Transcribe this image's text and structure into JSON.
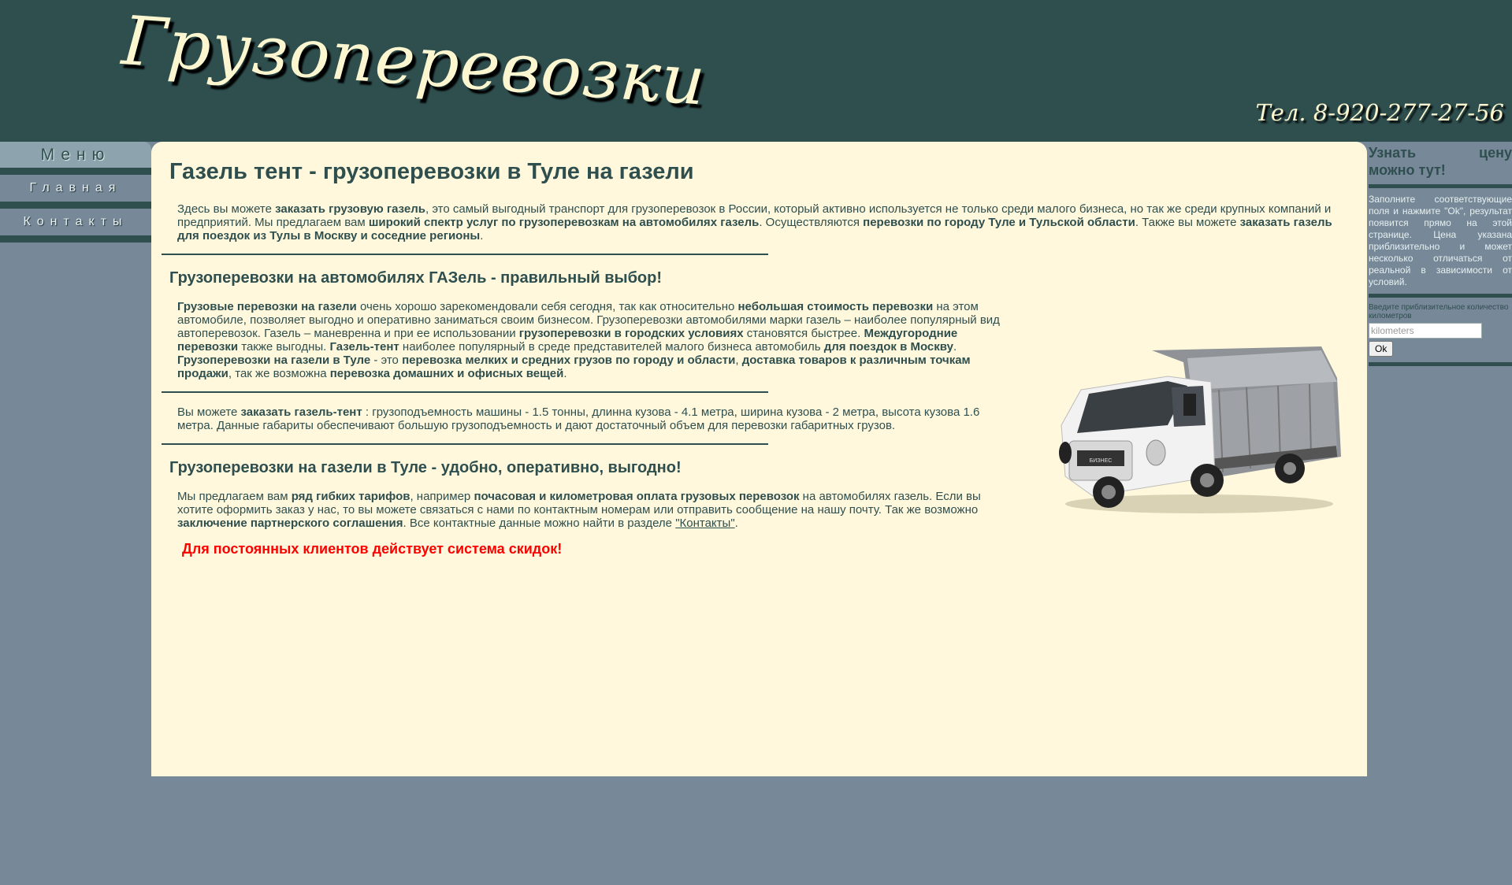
{
  "header": {
    "logo_text": "Грузоперевозки",
    "phone": "Тел. 8-920-277-27-56"
  },
  "nav": {
    "title": "Меню",
    "items": [
      {
        "label": "Главная"
      },
      {
        "label": "Контакты"
      }
    ]
  },
  "main": {
    "h1": "Газель тент - грузоперевозки в Туле на газели",
    "intro": {
      "t1": "Здесь вы можете ",
      "b1": "заказать грузовую газель",
      "t2": ", это самый выгодный транспорт для грузоперевозок в России, который активно используется не только среди малого бизнеса, но так же среди крупных компаний и предприятий. Мы предлагаем вам ",
      "b2": "широкий спектр услуг по грузоперевозкам на автомобилях газель",
      "t3": ". Осуществляются ",
      "b3": "перевозки по городу Туле и Тульской области",
      "t4": ". Также вы можете ",
      "b4": "заказать газель для поездок из Тулы в Москву и соседние регионы",
      "t5": "."
    },
    "h2_choice": "Грузоперевозки на автомобилях ГАЗель - правильный выбор!",
    "choice": {
      "b1": "Грузовые перевозки на газели",
      "t1": " очень хорошо зарекомендовали себя сегодня, так как относительно ",
      "b2": "небольшая стоимость перевозки",
      "t2": " на этом автомобиле, позволяет выгодно и оперативно заниматься своим бизнесом. Грузоперевозки автомобилями марки газель – наиболее популярный вид автоперевозок. Газель – маневренна и при ее использовании ",
      "b3": "грузоперевозки в городских условиях",
      "t3": " становятся быстрее. ",
      "b4": "Междугородние перевозки",
      "t4": " также выгодны. ",
      "b5": "Газель-тент",
      "t5": " наиболее популярный в среде представителей малого бизнеса автомобиль ",
      "b6": "для поездок в Москву",
      "t6": ". ",
      "b7": "Грузоперевозки на газели в Туле",
      "t7": " - это ",
      "b8": "перевозка мелких и средних грузов по городу и области",
      "t8": ", ",
      "b9": "доставка товаров к различным точкам продажи",
      "t9": ", так же возможна ",
      "b10": "перевозка домашних и офисных вещей",
      "t10": "."
    },
    "specs": {
      "t1": "Вы можете ",
      "b1": "заказать газель-тент",
      "t2": " : грузоподъемность машины - 1.5 тонны, длинна кузова - 4.1 метра, ширина кузова - 2 метра, высота кузова 1.6 метра. Данные габариты обеспечивают большую грузоподъемность и дают достаточный объем для перевозки габаритных грузов."
    },
    "h2_convenient": "Грузоперевозки на газели в Туле - удобно, оперативно, выгодно!",
    "offer": {
      "t1": "Мы предлагаем вам ",
      "b1": "ряд гибких тарифов",
      "t2": ", например ",
      "b2": "почасовая и километровая оплата грузовых перевозок",
      "t3": " на автомобилях газель. Если вы хотите оформить заказ у нас, то вы можете связаться с нами по контактным номерам или отправить сообщение на нашу почту. Так же возможно ",
      "b3": "заключение партнерского соглашения",
      "t4": ". Все контактные данные можно найти в разделе ",
      "link": "\"Контакты\"",
      "t5": "."
    },
    "discount": "Для постоянных клиентов действует система скидок!",
    "truck_plate": "БИЗНЕС"
  },
  "sidebar": {
    "title_line1": "Узнать цену",
    "title_line2": "можно тут!",
    "instructions": "Заполните соответствующие поля и нажмите \"Ok\", результат появится прямо на этой странице. Цена указана приблизительно и может несколько отличаться от реальной в зависимости от условий.",
    "km_label": "Введите приблизительное количество километров",
    "km_placeholder": "kilometers",
    "ok_label": "Ok"
  },
  "colors": {
    "header_bg": "#2f4f4f",
    "page_bg": "#778899",
    "content_bg": "#fff8dc",
    "discount": "#ff0000",
    "logo": "#fbf6cf"
  }
}
